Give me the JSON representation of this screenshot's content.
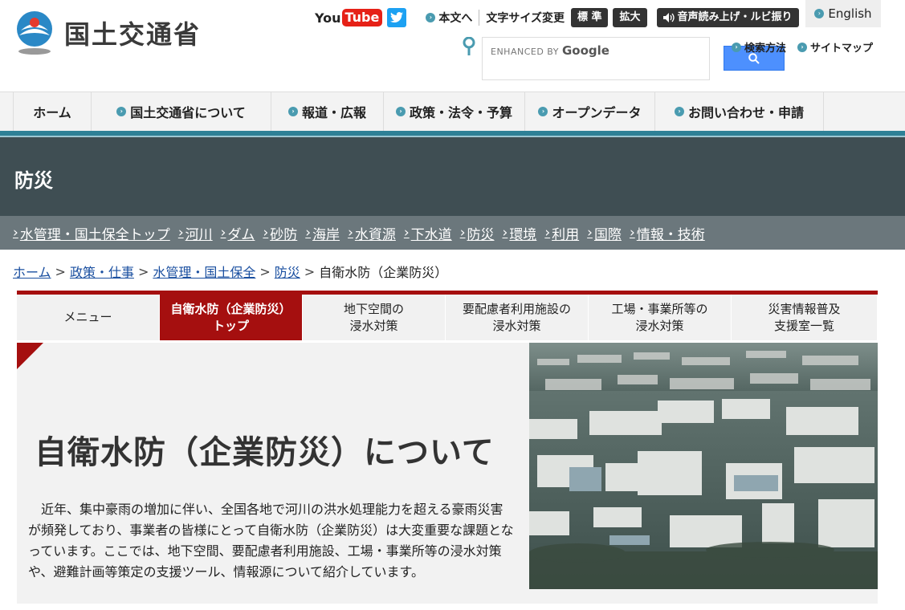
{
  "header": {
    "site_name": "国土交通省",
    "youtube_you": "You",
    "youtube_tube": "Tube",
    "skip_link": "本文へ",
    "font_size_label": "文字サイズ変更",
    "font_standard": "標 準",
    "font_large": "拡大",
    "voice_label": "音声読み上げ・ルビ振り",
    "english_label": "English",
    "search_placeholder_prefix": "ENHANCED BY",
    "search_placeholder_brand": "Google",
    "search_method": "検索方法",
    "sitemap": "サイトマップ"
  },
  "global_nav": [
    {
      "label": "ホーム",
      "icon": false,
      "width": 98
    },
    {
      "label": "国土交通省について",
      "icon": true,
      "width": 224
    },
    {
      "label": "報道・広報",
      "icon": true,
      "width": 140
    },
    {
      "label": "政策・法令・予算",
      "icon": true,
      "width": 176
    },
    {
      "label": "オープンデータ",
      "icon": true,
      "width": 162
    },
    {
      "label": "お問い合わせ・申請",
      "icon": true,
      "width": 210
    }
  ],
  "section": {
    "title": "防災",
    "sub_nav": [
      "水管理・国土保全トップ",
      "河川",
      "ダム",
      "砂防",
      "海岸",
      "水資源",
      "下水道",
      "防災",
      "環境",
      "利用",
      "国際",
      "情報・技術"
    ]
  },
  "breadcrumb": {
    "items": [
      "ホーム",
      "政策・仕事",
      "水管理・国土保全",
      "防災"
    ],
    "current": "自衛水防（企業防災）"
  },
  "tabs": [
    {
      "label": "メニュー",
      "active": false
    },
    {
      "label": "自衛水防（企業防災）\nトップ",
      "active": true
    },
    {
      "label": "地下空間の\n浸水対策",
      "active": false
    },
    {
      "label": "要配慮者利用施設の\n浸水対策",
      "active": false
    },
    {
      "label": "工場・事業所等の\n浸水対策",
      "active": false
    },
    {
      "label": "災害情報普及\n支援室一覧",
      "active": false
    }
  ],
  "hero": {
    "title": "自衛水防（企業防災）について",
    "text": "近年、集中豪雨の増加に伴い、全国各地で河川の洪水処理能力を超える豪雨災害が頻発しており、事業者の皆様にとって自衛水防（企業防災）は大変重要な課題となっています。ここでは、地下空間、要配慮者利用施設、工場・事業所等の浸水対策や、避難計画等策定の支援ツール、情報源について紹介しています。",
    "photo_icon": "flooded-industrial-area-photo"
  },
  "colors": {
    "accent_red": "#a50f0f",
    "nav_teal": "#2e8096",
    "band_dark": "#3f4e53",
    "subnav_grey": "#6b777c"
  }
}
